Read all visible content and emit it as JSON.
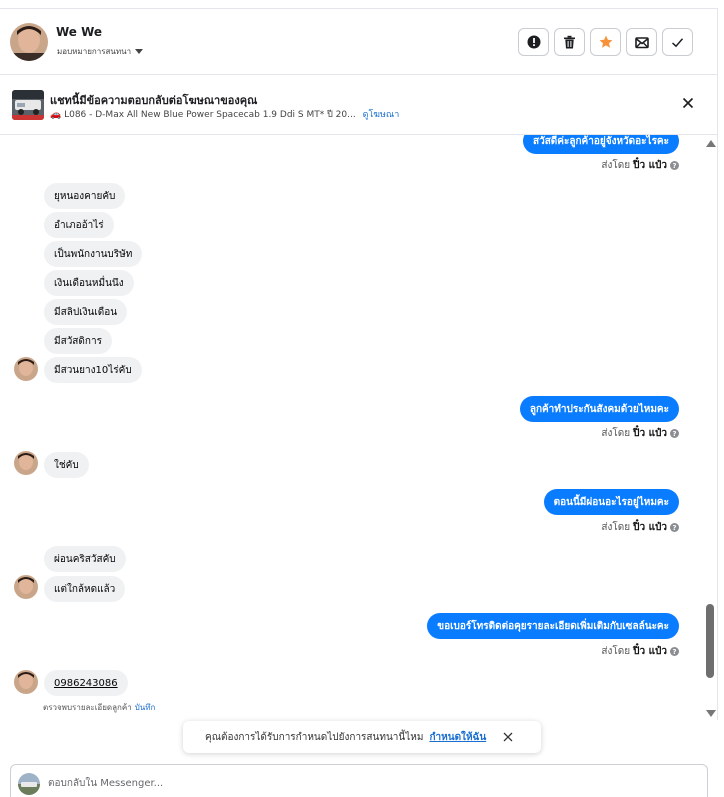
{
  "header": {
    "name": "We We",
    "assign_label": "มอบหมายการสนทนา",
    "buttons": [
      {
        "name": "spam-button",
        "icon": "alert-icon"
      },
      {
        "name": "delete-button",
        "icon": "trash-icon"
      },
      {
        "name": "star-button",
        "icon": "star-icon",
        "color": "#f7923a"
      },
      {
        "name": "mark-unread-button",
        "icon": "envelope-icon"
      },
      {
        "name": "done-button",
        "icon": "check-icon"
      }
    ]
  },
  "ad": {
    "title": "แชทนี้มีข้อความตอบกลับต่อโฆษณาของคุณ",
    "subtitle": "L086 - D-Max All New Blue Power Spacecab 1.9 Ddi S MT* ปี 20...",
    "link": "ดูโฆษณา"
  },
  "messages": {
    "out_top": "สวัสดีค่ะลูกค้าอยู่จังหวัดอะไรคะ",
    "in1": [
      "ยุหนองคายคับ",
      "อำเภออ้าไร่",
      "เป็นพนักงานบริษัท",
      "เงินเดือนหมื่นนึง",
      "มีสลิปเงินเดือน",
      "มีสวัสดิการ",
      "มีสวนยาง10ไร่คับ"
    ],
    "out2": "ลูกค้าทำประกันสังคมด้วยไหมคะ",
    "in2": "ใช่คับ",
    "out3": "ตอนนี้มีผ่อนอะไรอยู่ไหมคะ",
    "in3": [
      "ผ่อนคริสวัสคับ",
      "แต่ใกล้หดแล้ว"
    ],
    "out4": "ขอเบอร์โทรติดต่อคุยรายละเอียดเพิ่มเติมกับเซลล์นะคะ",
    "in4": "0986243086",
    "sent_prefix": "ส่งโดย",
    "sent_by": "ปิ๋ว แป๋ว",
    "detected_note": "ตรวจพบรายละเอียดลูกค้า",
    "save_link": "บันทึก"
  },
  "toast": {
    "text": "คุณต้องการได้รับการกำหนดไปยังการสนทนานี้ไหม",
    "link": "กำหนดให้ฉัน"
  },
  "composer": {
    "placeholder": "ตอบกลับใน Messenger..."
  },
  "colors": {
    "outgoing_bubble": "#0a7cff",
    "incoming_bubble": "#eff1f3",
    "link": "#1a6fd1"
  }
}
